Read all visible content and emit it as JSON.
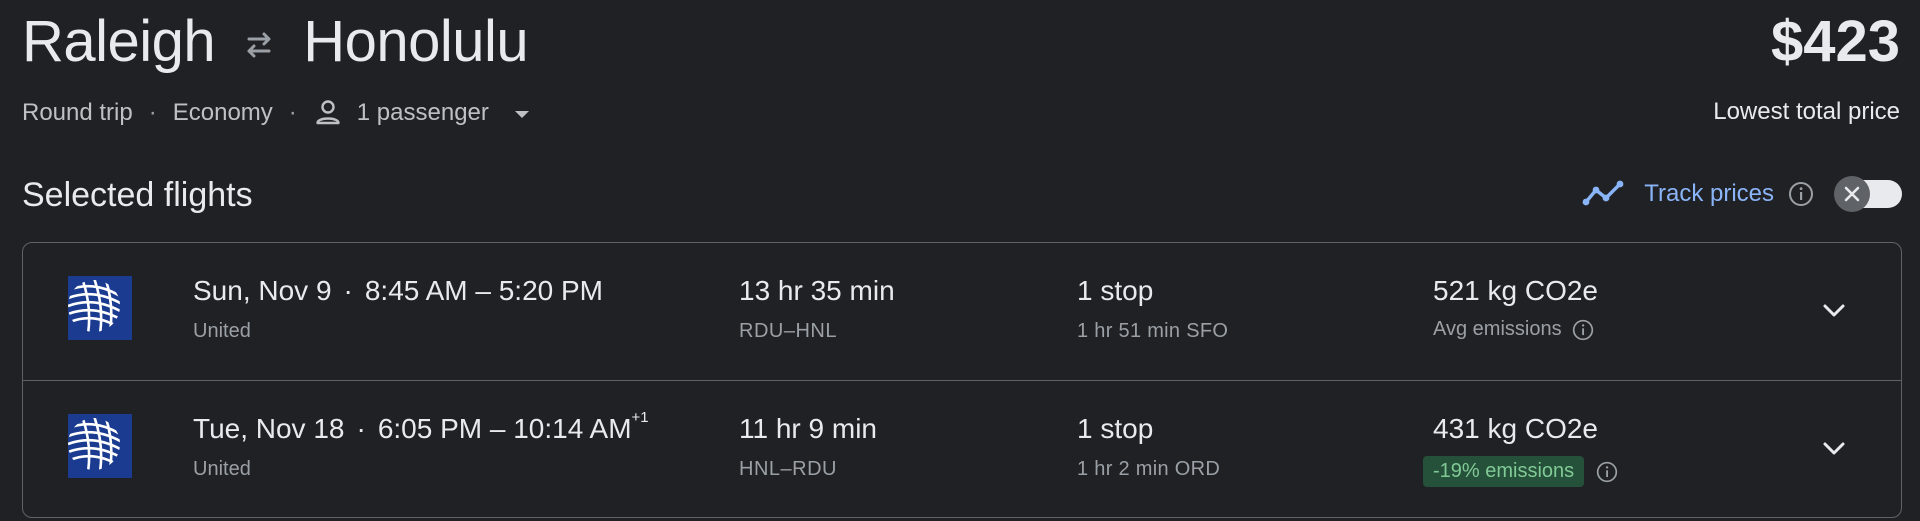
{
  "header": {
    "origin": "Raleigh",
    "destination": "Honolulu",
    "swap_icon": "swap-arrows-icon",
    "price": "$423",
    "price_caption": "Lowest total price"
  },
  "options": {
    "trip_type": "Round trip",
    "cabin": "Economy",
    "passengers": "1 passenger"
  },
  "selected": {
    "title": "Selected flights",
    "track_label": "Track prices"
  },
  "flights": [
    {
      "airline": "United",
      "date": "Sun, Nov 9",
      "times": "8:45 AM – 5:20 PM",
      "plus_days": "",
      "duration": "13 hr 35 min",
      "route": "RDU–HNL",
      "stops": "1 stop",
      "layover": "1 hr 51 min SFO",
      "co2": "521 kg CO2e",
      "emissions": "Avg emissions"
    },
    {
      "airline": "United",
      "date": "Tue, Nov 18",
      "times": "6:05 PM – 10:14 AM",
      "plus_days": "+1",
      "duration": "11 hr 9 min",
      "route": "HNL–RDU",
      "stops": "1 stop",
      "layover": "1 hr 2 min ORD",
      "co2": "431 kg CO2e",
      "emissions": "-19% emissions"
    }
  ],
  "colors": {
    "background": "#202124",
    "accent": "#8ab4f8",
    "emission_green": "#81c995"
  }
}
